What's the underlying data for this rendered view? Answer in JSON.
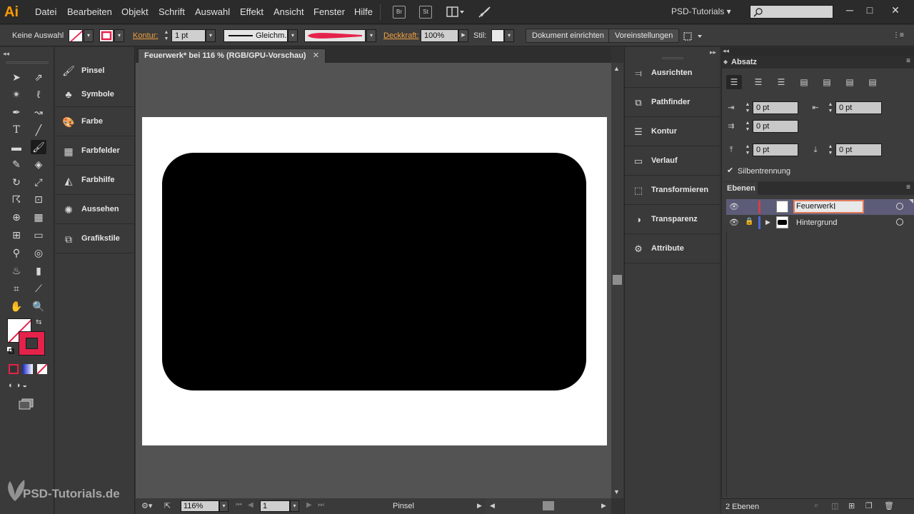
{
  "menubar": {
    "logo": "Ai",
    "menus": [
      "Datei",
      "Bearbeiten",
      "Objekt",
      "Schrift",
      "Auswahl",
      "Effekt",
      "Ansicht",
      "Fenster",
      "Hilfe"
    ],
    "bridge_label": "Br",
    "stock_label": "St",
    "workspace": "PSD-Tutorials",
    "search_placeholder": "",
    "window_controls": [
      "─",
      "□",
      "✕"
    ]
  },
  "controlbar": {
    "selection_label": "Keine Auswahl",
    "stroke_label": "Kontur:",
    "stroke_weight": "1 pt",
    "stroke_style": "Gleichm.",
    "opacity_label": "Deckkraft:",
    "opacity_value": "100%",
    "style_label": "Stil:",
    "document_setup": "Dokument einrichten",
    "preferences": "Voreinstellungen"
  },
  "colors": {
    "accent_red": "#e5224a",
    "layer_feuerwerk_color": "#d0404a",
    "layer_hintergrund_color": "#4c6ad8"
  },
  "tools": [
    "selection-tool",
    "direct-selection-tool",
    "magic-wand-tool",
    "lasso-tool",
    "pen-tool",
    "curvature-tool",
    "type-tool",
    "line-tool",
    "rectangle-tool",
    "paintbrush-tool",
    "pencil-tool",
    "eraser-tool",
    "rotate-tool",
    "scale-tool",
    "warp-tool",
    "free-transform-tool",
    "shape-builder-tool",
    "perspective-grid-tool",
    "mesh-tool",
    "gradient-tool",
    "eyedropper-tool",
    "blend-tool",
    "symbol-sprayer-tool",
    "column-graph-tool",
    "artboard-tool",
    "slice-tool",
    "hand-tool",
    "zoom-tool"
  ],
  "left_panels": [
    {
      "label": "Pinsel",
      "icon": "brush-icon"
    },
    {
      "label": "Symbole",
      "icon": "symbols-icon"
    },
    {
      "label": "Farbe",
      "icon": "palette-icon"
    },
    {
      "label": "Farbfelder",
      "icon": "swatches-icon"
    },
    {
      "label": "Farbhilfe",
      "icon": "color-guide-icon"
    },
    {
      "label": "Aussehen",
      "icon": "appearance-icon"
    },
    {
      "label": "Grafikstile",
      "icon": "graphic-styles-icon"
    }
  ],
  "document": {
    "tab_title": "Feuerwerk* bei 116 % (RGB/GPU-Vorschau)",
    "zoom": "116%",
    "artboard_number": "1",
    "active_tool_name": "Pinsel"
  },
  "right_panels": [
    {
      "label": "Ausrichten",
      "icon": "align-icon"
    },
    {
      "label": "Pathfinder",
      "icon": "pathfinder-icon"
    },
    {
      "label": "Kontur",
      "icon": "stroke-icon"
    },
    {
      "label": "Verlauf",
      "icon": "gradient-icon"
    },
    {
      "label": "Transformieren",
      "icon": "transform-icon"
    },
    {
      "label": "Transparenz",
      "icon": "transparency-icon"
    },
    {
      "label": "Attribute",
      "icon": "attributes-icon"
    }
  ],
  "paragraph": {
    "title": "Absatz",
    "left_indent": "0 pt",
    "right_indent": "0 pt",
    "first_line_indent": "0 pt",
    "space_before": "0 pt",
    "space_after": "0 pt",
    "hyphenation_label": "Silbentrennung",
    "hyphenation_checked": true
  },
  "layers": {
    "title": "Ebenen",
    "items": [
      {
        "name": "Feuerwerk",
        "editing": true
      },
      {
        "name": "Hintergrund",
        "editing": false
      }
    ],
    "count_label": "2 Ebenen"
  },
  "watermark": "PSD-Tutorials.de"
}
